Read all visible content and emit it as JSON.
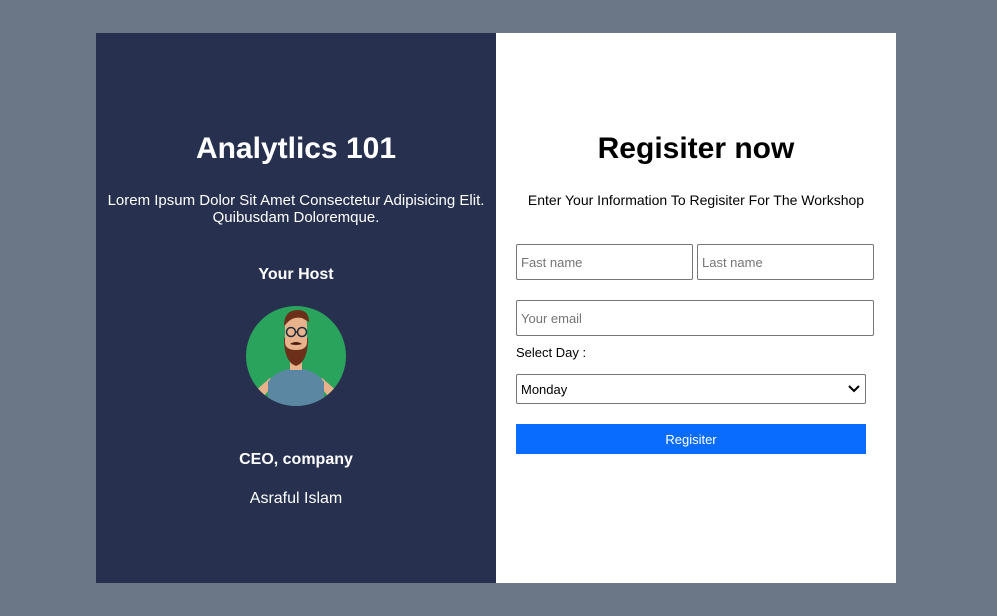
{
  "host_panel": {
    "title": "Analytlics 101",
    "description": "Lorem Ipsum Dolor Sit Amet Consectetur Adipisicing Elit. Quibusdam Doloremque.",
    "host_heading": "Your Host",
    "avatar_icon": "person-avatar-icon",
    "role": "CEO, company",
    "name": "Asraful Islam"
  },
  "register_panel": {
    "title": "Regisiter now",
    "subtitle": "Enter Your Information To Regisiter For The Workshop",
    "first_name": {
      "placeholder": "Fast name",
      "value": ""
    },
    "last_name": {
      "placeholder": "Last name",
      "value": ""
    },
    "email": {
      "placeholder": "Your email",
      "value": ""
    },
    "select_label": "Select Day :",
    "select_value": "Monday",
    "submit_label": "Regisiter"
  },
  "colors": {
    "page_background": "#6b7687",
    "host_panel_background": "#27314f",
    "form_background": "#ffffff",
    "avatar_background": "#2aa45c",
    "submit_background": "#0a6cff"
  }
}
